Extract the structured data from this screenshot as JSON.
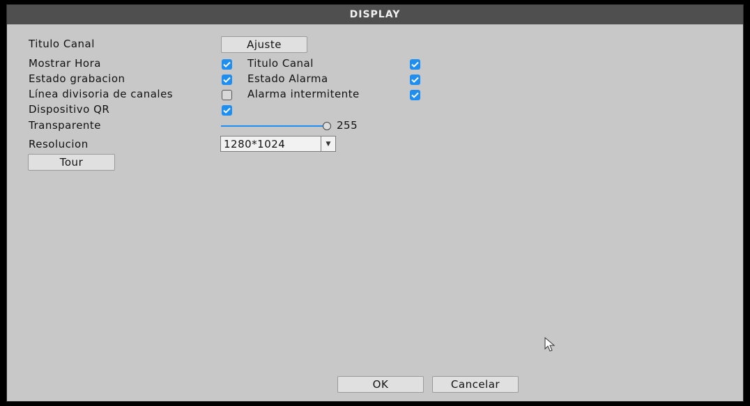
{
  "window": {
    "title": "DISPLAY"
  },
  "settings": {
    "titulo_canal_label": "Titulo Canal",
    "ajuste_button": "Ajuste",
    "mostrar_hora": {
      "label": "Mostrar Hora",
      "checked": true
    },
    "titulo_canal": {
      "label": "Titulo Canal",
      "checked": true
    },
    "estado_grabacion": {
      "label": "Estado grabacion",
      "checked": true
    },
    "estado_alarma": {
      "label": "Estado Alarma",
      "checked": true
    },
    "linea_divisoria": {
      "label": "Línea divisoria de canales",
      "checked": false
    },
    "alarma_intermitente": {
      "label": "Alarma intermitente",
      "checked": true
    },
    "dispositivo_qr": {
      "label": "Dispositivo QR",
      "checked": true
    },
    "transparente": {
      "label": "Transparente",
      "value": "255",
      "fraction": 1.0
    },
    "resolucion": {
      "label": "Resolucion",
      "value": "1280*1024"
    },
    "tour_button": "Tour"
  },
  "footer": {
    "ok_label": "OK",
    "cancel_label": "Cancelar"
  },
  "colors": {
    "accent": "#1e8ef0",
    "title_bar": "#4f4f4f",
    "panel": "#c8c8c8"
  },
  "icons": {
    "check": "check-icon",
    "dropdown": "chevron-down-icon",
    "cursor": "mouse-pointer-icon"
  }
}
